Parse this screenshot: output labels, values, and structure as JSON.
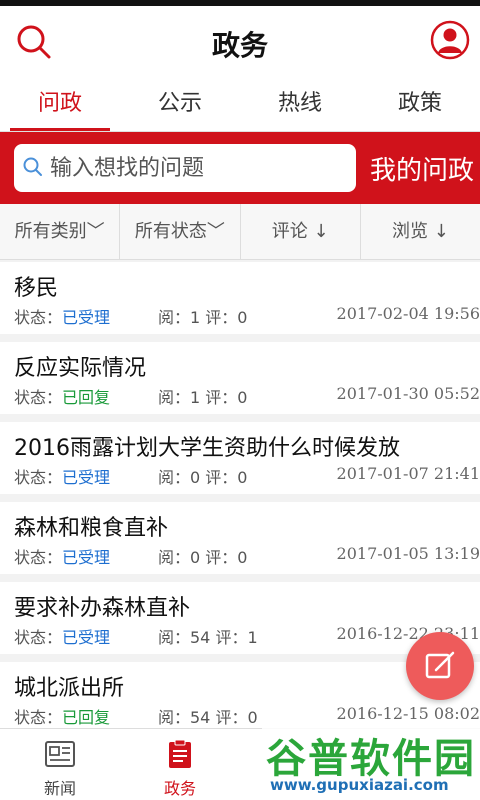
{
  "header": {
    "title": "政务"
  },
  "tabs": [
    {
      "label": "问政"
    },
    {
      "label": "公示"
    },
    {
      "label": "热线"
    },
    {
      "label": "政策"
    }
  ],
  "search": {
    "placeholder": "输入想找的问题",
    "my_label": "我的问政"
  },
  "filters": [
    {
      "label": "所有类别﹀"
    },
    {
      "label": "所有状态﹀"
    },
    {
      "label": "评论 ↓"
    },
    {
      "label": "浏览 ↓"
    }
  ],
  "items": [
    {
      "question": "移民",
      "status_label": "状态：",
      "status": "已受理",
      "counts": "阅：1  评：0",
      "date": "2017-02-04 19:56"
    },
    {
      "question": "反应实际情况",
      "status_label": "状态：",
      "status": "已回复",
      "counts": "阅：1  评：0",
      "date": "2017-01-30 05:52"
    },
    {
      "question": "2016雨露计划大学生资助什么时候发放",
      "status_label": "状态：",
      "status": "已受理",
      "counts": "阅：0  评：0",
      "date": "2017-01-07 21:41"
    },
    {
      "question": "森林和粮食直补",
      "status_label": "状态：",
      "status": "已受理",
      "counts": "阅：0  评：0",
      "date": "2017-01-05 13:19"
    },
    {
      "question": "要求补办森林直补",
      "status_label": "状态：",
      "status": "已受理",
      "counts": "阅：54  评：1",
      "date": "2016-12-22 23:11"
    },
    {
      "question": "城北派出所",
      "status_label": "状态：",
      "status": "已回复",
      "counts": "阅：54  评：0",
      "date": "2016-12-15 08:02"
    }
  ],
  "bottom_nav": [
    {
      "label": "新闻",
      "icon": "newspaper-icon"
    },
    {
      "label": "政务",
      "icon": "document-icon"
    }
  ],
  "watermark": {
    "big": "谷普软件园",
    "small": "www.gupuxiazai.com"
  },
  "colors": {
    "accent": "#d0121b",
    "accepted": "#1e6fd0",
    "replied": "#1a9a3a",
    "fab": "#ee5b5b"
  }
}
